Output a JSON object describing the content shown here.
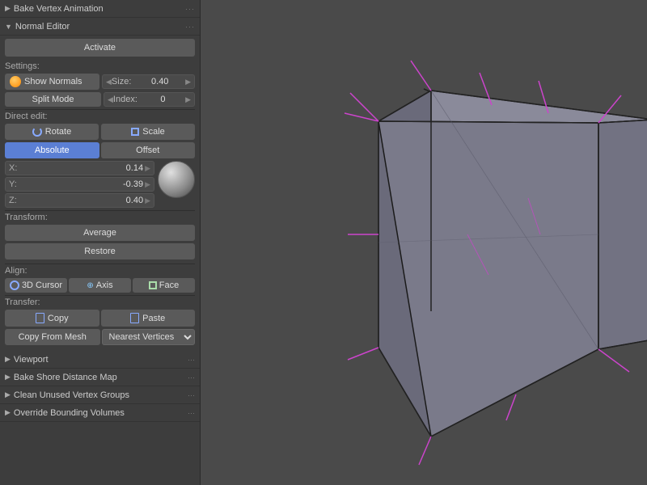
{
  "leftPanel": {
    "bakeVertexAnim": {
      "label": "Bake Vertex Animation",
      "collapsed": true
    },
    "normalEditor": {
      "sectionLabel": "Normal Editor",
      "activateBtn": "Activate",
      "settings": {
        "label": "Settings:",
        "showNormalsBtn": "Show Normals",
        "sizeLabel": "Size:",
        "sizeValue": "0.40",
        "splitModeBtn": "Split Mode",
        "indexLabel": "Index:",
        "indexValue": "0"
      },
      "directEdit": {
        "label": "Direct edit:",
        "rotateBtn": "Rotate",
        "scaleBtn": "Scale",
        "absoluteTab": "Absolute",
        "offsetTab": "Offset",
        "xLabel": "X:",
        "xValue": "0.14",
        "yLabel": "Y:",
        "yValue": "-0.39",
        "zLabel": "Z:",
        "zValue": "0.40"
      },
      "transform": {
        "label": "Transform:",
        "averageBtn": "Average",
        "restoreBtn": "Restore"
      },
      "align": {
        "label": "Align:",
        "cursorBtn": "3D Cursor",
        "axisBtn": "Axis",
        "faceBtn": "Face"
      },
      "transfer": {
        "label": "Transfer:",
        "copyBtn": "Copy",
        "pasteBtn": "Paste",
        "copyFromMeshBtn": "Copy From Mesh",
        "nearestVerticesOption": "Nearest Vertices"
      }
    },
    "viewport": {
      "label": "Viewport",
      "collapsed": true
    },
    "bakeShoreDistance": {
      "label": "Bake Shore Distance Map",
      "collapsed": true
    },
    "cleanUnused": {
      "label": "Clean Unused Vertex Groups",
      "collapsed": true
    },
    "overrideBounding": {
      "label": "Override Bounding Volumes",
      "collapsed": true
    }
  }
}
